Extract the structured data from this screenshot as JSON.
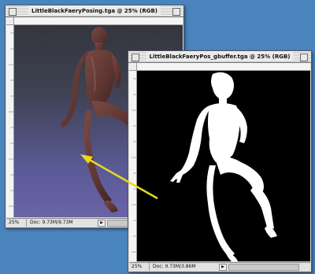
{
  "window1": {
    "title": "LittleBlackFaeryPosing.tga @ 25% (RGB)",
    "zoom": "25%",
    "doc": "Doc: 9.73M/9.73M"
  },
  "window2": {
    "title": "LittleBlackFaeryPos_gbuffer.tga @ 25% (RGB)",
    "zoom": "25%",
    "doc": "Doc: 9.73M/3.86M"
  },
  "colors": {
    "desktop": "#4a84bc",
    "arrow": "#e8d820",
    "render_bg_top": "#33353e",
    "render_bg_bottom": "#6a64a6",
    "gbuffer_bg": "#000000",
    "silhouette": "#ffffff"
  },
  "icons": [
    "close-box-icon",
    "zoom-box-icon",
    "scroll-arrow-icon"
  ]
}
